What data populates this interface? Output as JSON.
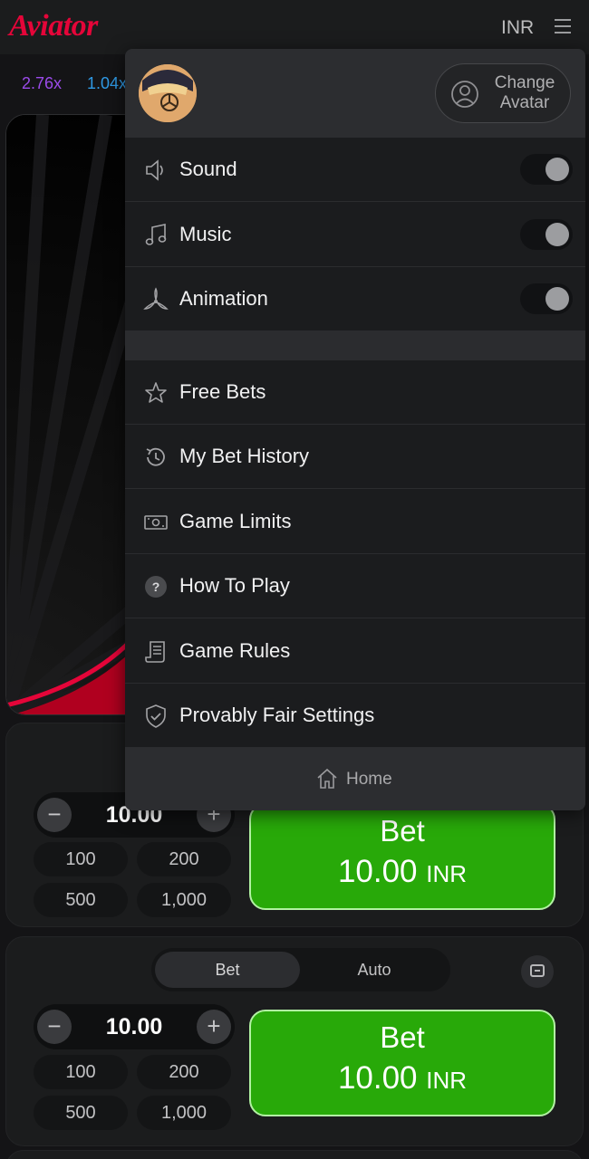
{
  "header": {
    "logo": "Aviator",
    "currency": "INR",
    "menu_icon": "hamburger-icon"
  },
  "history": [
    {
      "value": "2.76x",
      "color": "#9b4bea"
    },
    {
      "value": "1.04x",
      "color": "#2f9ae6"
    }
  ],
  "menu": {
    "change_avatar": "Change Avatar",
    "change_avatar_line1": "Change",
    "change_avatar_line2": "Avatar",
    "toggles": [
      {
        "label": "Sound",
        "icon": "speaker-icon",
        "on": false
      },
      {
        "label": "Music",
        "icon": "music-note-icon",
        "on": false
      },
      {
        "label": "Animation",
        "icon": "propeller-icon",
        "on": false
      }
    ],
    "items": [
      {
        "label": "Free Bets",
        "icon": "star-icon"
      },
      {
        "label": "My Bet History",
        "icon": "history-icon"
      },
      {
        "label": "Game Limits",
        "icon": "banknote-icon"
      },
      {
        "label": "How To Play",
        "icon": "question-icon"
      },
      {
        "label": "Game Rules",
        "icon": "scroll-icon"
      },
      {
        "label": "Provably Fair Settings",
        "icon": "shield-check-icon"
      }
    ],
    "home": "Home"
  },
  "panel1": {
    "amount": "10.00",
    "quick": [
      "100",
      "200",
      "500",
      "1,000"
    ],
    "bet_label": "Bet",
    "bet_amount": "10.00",
    "bet_currency": "INR"
  },
  "panel2": {
    "tabs": [
      "Bet",
      "Auto"
    ],
    "active_tab": "Bet",
    "amount": "10.00",
    "quick": [
      "100",
      "200",
      "500",
      "1,000"
    ],
    "bet_label": "Bet",
    "bet_amount": "10.00",
    "bet_currency": "INR"
  },
  "colors": {
    "brand_red": "#e50539",
    "bet_green": "#28a909",
    "background": "#141416"
  }
}
